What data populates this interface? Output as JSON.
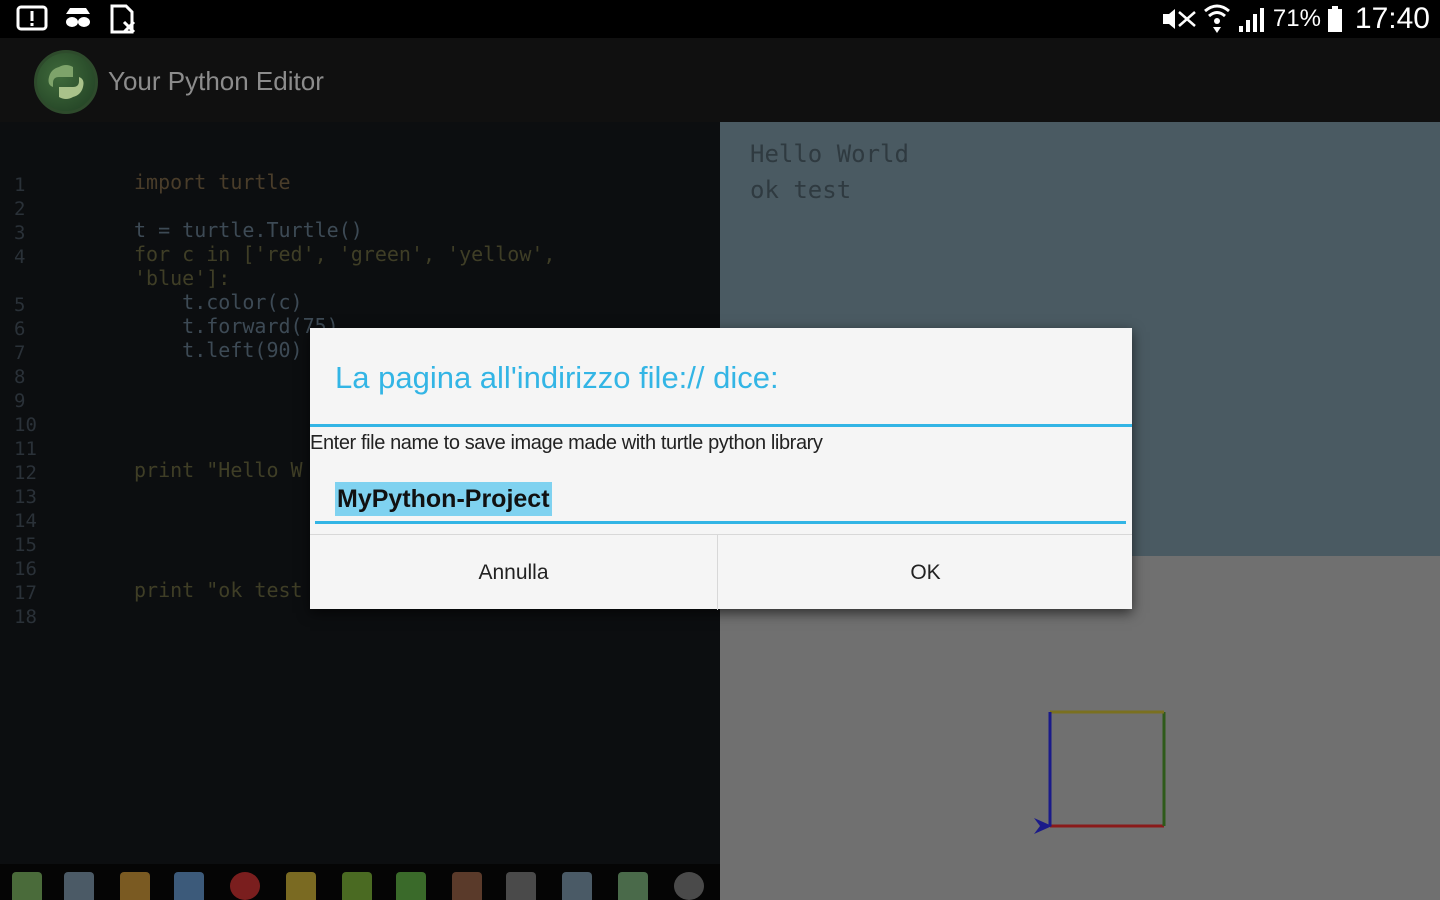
{
  "status_bar": {
    "icons": [
      "alert-icon",
      "incognito-icon",
      "file-blocked-icon"
    ],
    "right_icons": [
      "mute-icon",
      "wifi-icon",
      "signal-icon"
    ],
    "battery": "71%",
    "clock": "17:40"
  },
  "app_bar": {
    "title": "Your Python Editor",
    "logo_icon": "python-logo-icon"
  },
  "editor": {
    "line_numbers": [
      "1",
      "2",
      "3",
      "4",
      "5",
      "6",
      "7",
      "8",
      "9",
      "10",
      "11",
      "12",
      "13",
      "14",
      "15",
      "16",
      "17",
      "18"
    ],
    "code_lines": [
      "import turtle",
      "t = turtle.Turtle()",
      "for c in ['red', 'green', 'yellow',",
      "'blue']:",
      "    t.color(c)",
      "    t.forward(75)",
      "    t.left(90)",
      "print \"Hello W",
      "print \"ok test"
    ]
  },
  "output": {
    "lines": [
      "Hello World",
      "ok test"
    ]
  },
  "toolbar": {
    "buttons": [
      "new-file-icon",
      "save-icon",
      "open-folder-icon",
      "print-icon",
      "pdf-icon",
      "clipboard-icon",
      "undo-icon",
      "redo-icon",
      "search-icon",
      "home-icon",
      "copy-icon",
      "export-icon",
      "settings-icon"
    ]
  },
  "dialog": {
    "title": "La pagina all'indirizzo file:// dice:",
    "message": "Enter file name to save image made with turtle python library",
    "input_value": "MyPython-Project",
    "cancel_label": "Annulla",
    "ok_label": "OK"
  },
  "colors": {
    "accent": "#33b5e5",
    "output_bg": "#4a5a62",
    "canvas_bg": "#707070",
    "editor_bg": "#0c0e10"
  }
}
